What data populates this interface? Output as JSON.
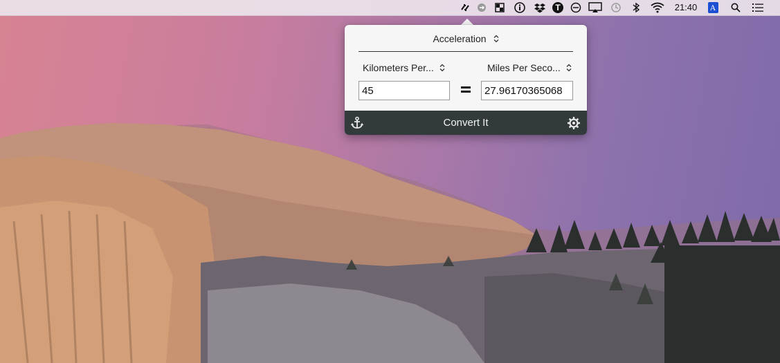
{
  "menubar": {
    "clock": "21:40",
    "status_icons": [
      "unit-converter-icon",
      "circle-arrow-icon",
      "grid-app-icon",
      "info-icon",
      "dropbox-icon",
      "t-app-icon",
      "no-entry-icon",
      "airplay-icon",
      "time-machine-icon",
      "bluetooth-icon",
      "wifi-icon",
      "input-source-icon",
      "spotlight-search-icon",
      "notification-center-icon"
    ],
    "input_source_label": "A",
    "t_app_label": "T"
  },
  "converter": {
    "category": "Acceleration",
    "from_unit": "Kilometers Per...",
    "to_unit": "Miles Per Seco...",
    "from_value": "45",
    "to_value": "27.96170365068",
    "convert_label": "Convert It"
  },
  "colors": {
    "footer_bg": "#333a3c",
    "popover_bg": "#f6f6f6",
    "sky_pink": "#d78392",
    "sky_purple": "#7e6aa8"
  }
}
